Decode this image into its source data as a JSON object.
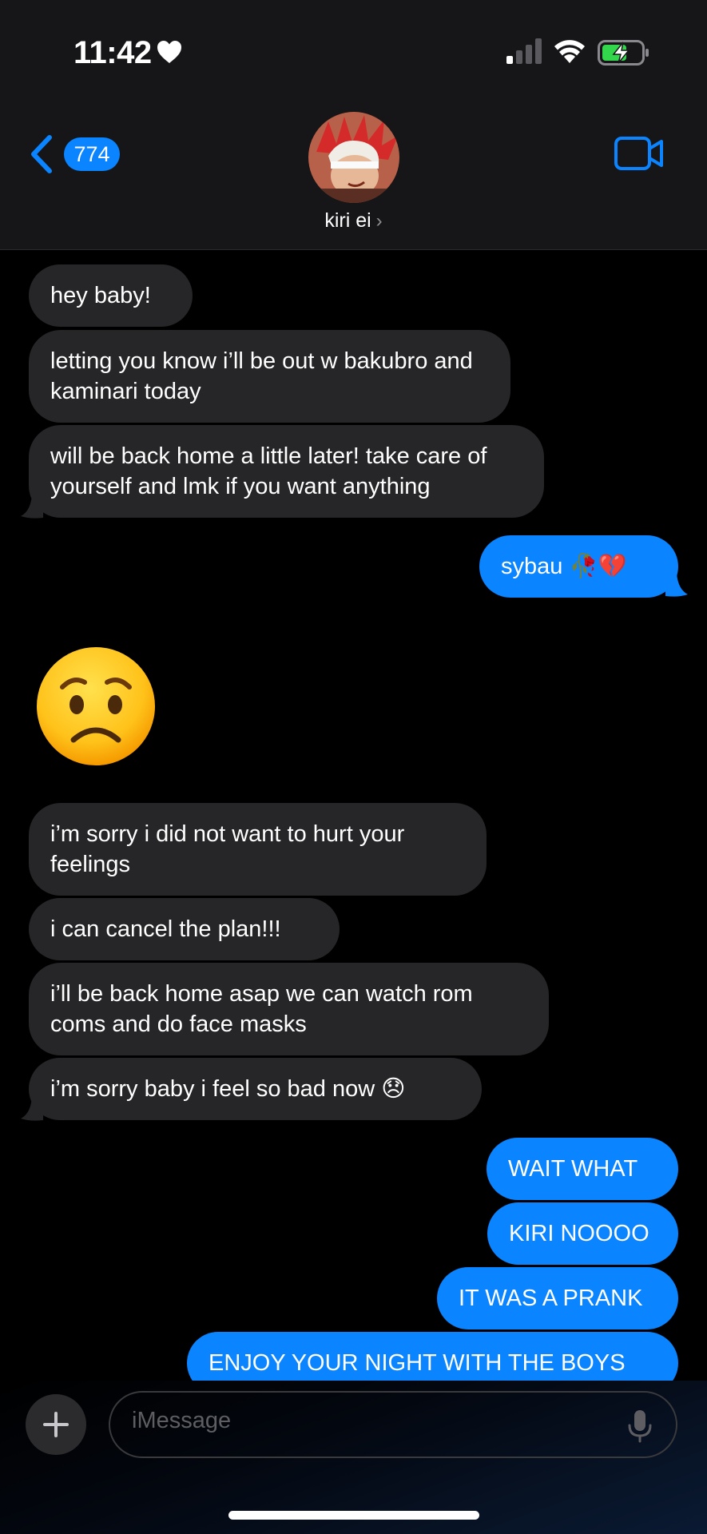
{
  "status_bar": {
    "time": "11:42",
    "heart": "heart-icon",
    "signal": "cellular-signal-icon",
    "wifi": "wifi-icon",
    "battery": "battery-charging-icon"
  },
  "header": {
    "back_count": "774",
    "contact_name": "kiri ei",
    "contact_chevron": "›",
    "video_icon": "video-camera-icon"
  },
  "messages": [
    {
      "dir": "in",
      "text": "hey baby!"
    },
    {
      "dir": "in",
      "text": "letting you know i’ll be out w bakubro and kaminari today"
    },
    {
      "dir": "in",
      "text": "will be back home a little later! take care of yourself and lmk if you want anything"
    },
    {
      "dir": "out",
      "text": "sybau 🥀💔"
    },
    {
      "dir": "in",
      "text": "😟",
      "kind": "big-emoji"
    },
    {
      "dir": "in",
      "text": "i’m sorry i did not want to hurt your feelings"
    },
    {
      "dir": "in",
      "text": "i can cancel the plan!!!"
    },
    {
      "dir": "in",
      "text": "i’ll be back home asap we can watch rom coms and do face masks"
    },
    {
      "dir": "in",
      "text": "i’m sorry baby i feel so bad now 😞"
    },
    {
      "dir": "out",
      "text": "WAIT WHAT"
    },
    {
      "dir": "out",
      "text": "KIRI NOOOO"
    },
    {
      "dir": "out",
      "text": "IT WAS A PRANK"
    },
    {
      "dir": "out",
      "text": "ENJOY YOUR NIGHT WITH THE BOYS"
    }
  ],
  "composer": {
    "placeholder": "iMessage",
    "plus_icon": "plus-icon",
    "mic_icon": "microphone-icon"
  },
  "colors": {
    "outgoing": "#0a84ff",
    "incoming": "#262628",
    "background": "#000000"
  }
}
